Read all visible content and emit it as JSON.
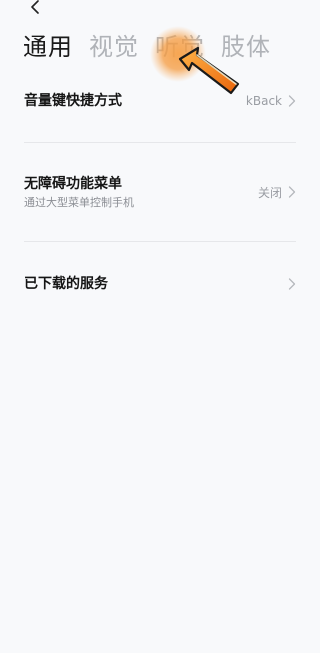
{
  "tabs": [
    {
      "label": "通用",
      "active": true
    },
    {
      "label": "视觉",
      "active": false
    },
    {
      "label": "听觉",
      "active": false
    },
    {
      "label": "肢体",
      "active": false
    }
  ],
  "settings": [
    {
      "title": "音量键快捷方式",
      "subtitle": "",
      "value": "kBack"
    },
    {
      "title": "无障碍功能菜单",
      "subtitle": "通过大型菜单控制手机",
      "value": "关闭"
    },
    {
      "title": "已下载的服务",
      "subtitle": "",
      "value": ""
    }
  ],
  "icons": {
    "back": "back-arrow-icon",
    "chevron": "chevron-right-icon",
    "overlay": "tap-pointer-arrow-icon"
  },
  "colors": {
    "background": "#f8f9fb",
    "tab_active": "#1a1a1a",
    "tab_inactive": "#b0b3b8",
    "overlay_orange": "#f08a1c"
  }
}
